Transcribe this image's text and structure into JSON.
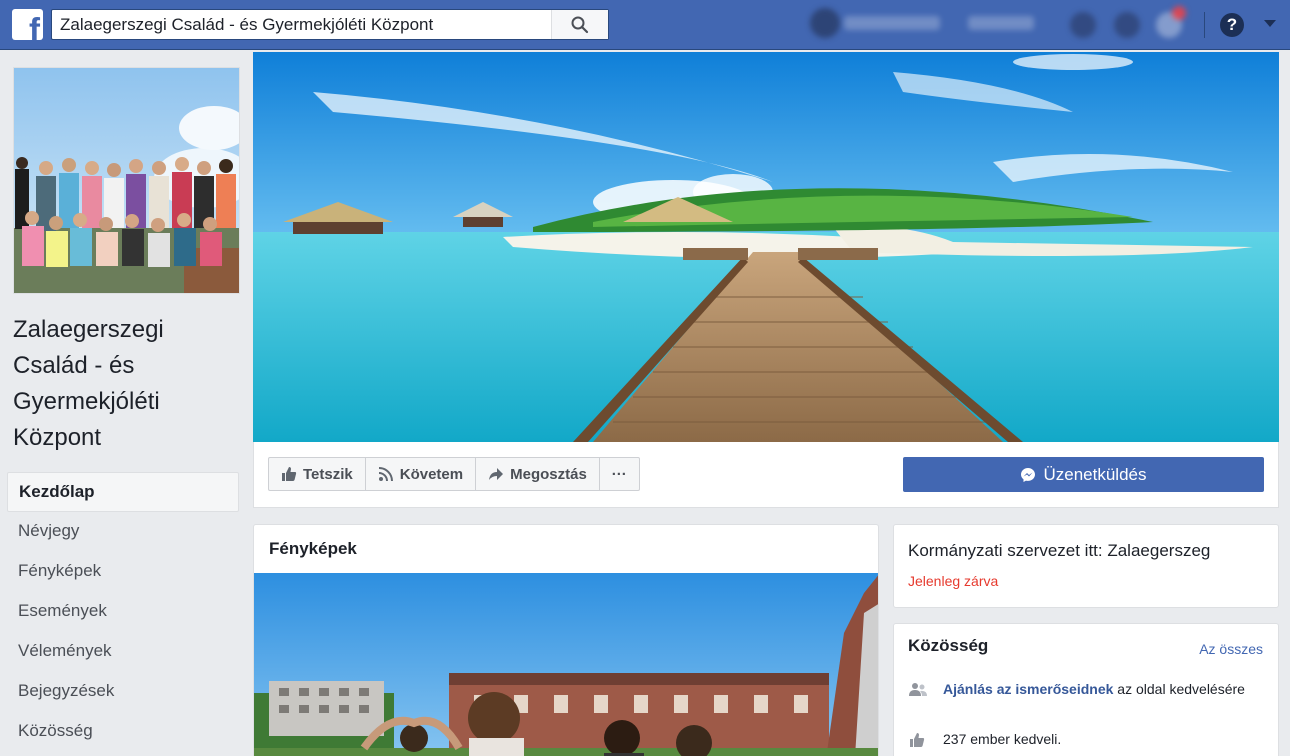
{
  "search": {
    "value": "Zalaegerszegi Család - és Gyermekjóléti Központ"
  },
  "page": {
    "name": "Zalaegerszegi Család - és Gyermekjóléti Központ"
  },
  "nav": {
    "items": [
      {
        "label": "Kezdőlap"
      },
      {
        "label": "Névjegy"
      },
      {
        "label": "Fényképek"
      },
      {
        "label": "Események"
      },
      {
        "label": "Vélemények"
      },
      {
        "label": "Bejegyzések"
      },
      {
        "label": "Közösség"
      }
    ]
  },
  "actions": {
    "like": "Tetszik",
    "follow": "Követem",
    "share": "Megosztás",
    "more": "···",
    "message": "Üzenetküldés"
  },
  "photos": {
    "title": "Fényképek"
  },
  "info": {
    "line": "Kormányzati szervezet itt: Zalaegerszeg",
    "status": "Jelenleg zárva"
  },
  "community": {
    "title": "Közösség",
    "see_all": "Az összes",
    "invite_link": "Ajánlás az ismerőseidnek",
    "invite_rest": " az oldal kedvelésére",
    "likes": "237 ember kedveli."
  },
  "colors": {
    "brand": "#4267b2",
    "status_closed": "#e63a2e",
    "link": "#365899"
  }
}
